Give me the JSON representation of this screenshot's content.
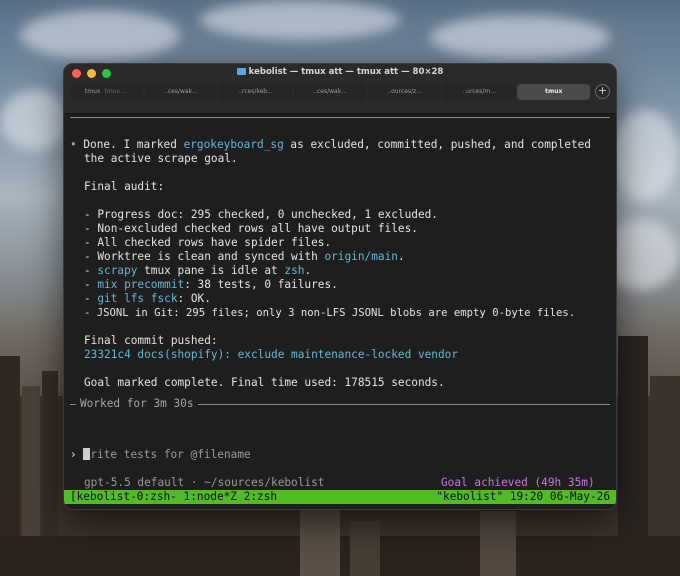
{
  "window": {
    "title": "kebolist — tmux att — tmux att — 80×28",
    "tabs": [
      {
        "label": "tmux",
        "sub": "tmux ..."
      },
      {
        "label": "..ces/wak..."
      },
      {
        "label": "..rces/keb..."
      },
      {
        "label": "..ces/wak..."
      },
      {
        "label": "..ources/z..."
      },
      {
        "label": "..urces/m..."
      },
      {
        "label": "tmux",
        "active": true
      }
    ],
    "new_tab": "+"
  },
  "terminal": {
    "bullet": "•",
    "line1_pre": "Done. I marked ",
    "line1_link": "ergokeyboard_sg",
    "line1_post": " as excluded, committed, pushed, and completed",
    "line2": "the active scrape goal.",
    "audit_heading": "Final audit:",
    "audit_items": [
      "- Progress doc: 295 checked, 0 unchecked, 1 excluded.",
      "- Non-excluded checked rows all have output files.",
      "- All checked rows have spider files."
    ],
    "worktree_pre": "- Worktree is clean and synced with ",
    "worktree_link": "origin/main",
    "worktree_post": ".",
    "scrapy_pre": "- ",
    "scrapy_cmd": "scrapy",
    "scrapy_mid": " tmux pane is idle at ",
    "scrapy_zsh": "zsh",
    "scrapy_post": ".",
    "mix_pre": "- ",
    "mix_cmd": "mix precommit",
    "mix_post": ": 38 tests, 0 failures.",
    "git_pre": "- ",
    "git_cmd": "git lfs fsck",
    "git_post": ": OK.",
    "jsonl": "- JSONL in Git: 295 files; only 3 non-LFS JSONL blobs are empty 0-byte files.",
    "commit_heading": "Final commit pushed:",
    "commit": "23321c4 docs(shopify): exclude maintenance-locked vendor",
    "goal_line": "Goal marked complete. Final time used: 178515 seconds.",
    "worked": "Worked for 3m 30s",
    "prompt_symbol": "›",
    "prompt_placeholder": "rite tests for @filename",
    "model_info": "gpt-5.5 default · ~/sources/kebolist",
    "goal_status": "Goal achieved (49h 35m)"
  },
  "statusbar": {
    "left": "[kebolist-0:zsh- 1:node*Z 2:zsh",
    "right": "\"kebolist\" 19:20 06-May-26"
  },
  "colors": {
    "accent_cyan": "#67b8d3",
    "status_green": "#4fbe1e",
    "goal_purple": "#c678dd"
  }
}
